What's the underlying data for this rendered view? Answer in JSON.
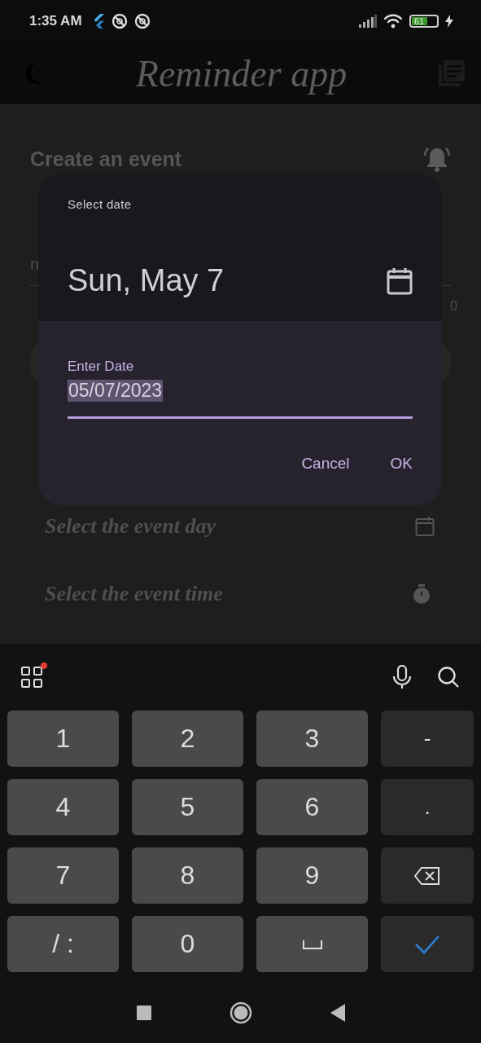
{
  "status_bar": {
    "time": "1:35 AM",
    "battery": "61"
  },
  "app_bar": {
    "title": "Reminder app"
  },
  "form": {
    "heading": "Create an event",
    "name_field": {
      "placeholder": "n"
    },
    "counter": "0",
    "pickers": [
      {
        "kind": "day",
        "label": "Select the event day"
      },
      {
        "kind": "time",
        "label": "Select the event time"
      }
    ]
  },
  "dialog": {
    "title": "Select date",
    "headline": "Sun, May 7",
    "field": {
      "label": "Enter Date",
      "value": "05/07/2023",
      "text_selected": true
    },
    "buttons": [
      "Cancel",
      "OK"
    ]
  },
  "keyboard": {
    "toolbar": {
      "badge": true
    },
    "keys": [
      {
        "kind": "digit",
        "label": "1"
      },
      {
        "kind": "digit",
        "label": "2"
      },
      {
        "kind": "digit",
        "label": "3"
      },
      {
        "kind": "symbol",
        "label": "-"
      },
      {
        "kind": "digit",
        "label": "4"
      },
      {
        "kind": "digit",
        "label": "5"
      },
      {
        "kind": "digit",
        "label": "6"
      },
      {
        "kind": "symbol",
        "label": "."
      },
      {
        "kind": "digit",
        "label": "7"
      },
      {
        "kind": "digit",
        "label": "8"
      },
      {
        "kind": "digit",
        "label": "9"
      },
      {
        "kind": "backspace"
      },
      {
        "kind": "digit",
        "label": "/ :"
      },
      {
        "kind": "digit",
        "label": "0"
      },
      {
        "kind": "space"
      },
      {
        "kind": "enter"
      }
    ]
  }
}
